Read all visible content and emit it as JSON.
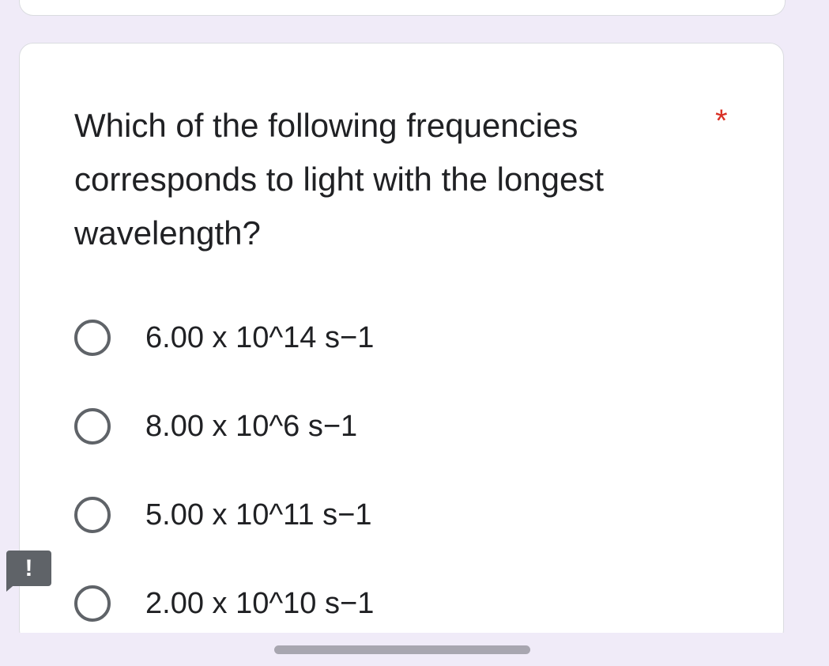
{
  "question": {
    "text": "Which of the following frequencies corresponds to light with the longest wavelength?",
    "required_marker": "*"
  },
  "options": [
    {
      "label": "6.00 x 10^14 s−1",
      "selected": false
    },
    {
      "label": "8.00 x 10^6 s−1",
      "selected": false
    },
    {
      "label": "5.00 x 10^11 s−1",
      "selected": false
    },
    {
      "label": "2.00 x 10^10 s−1",
      "selected": false
    }
  ],
  "report_button": {
    "glyph": "!"
  },
  "colors": {
    "background": "#f0ebf8",
    "card": "#ffffff",
    "required": "#d93025",
    "radio_border": "#5f6368",
    "report_badge": "#5f6368"
  }
}
